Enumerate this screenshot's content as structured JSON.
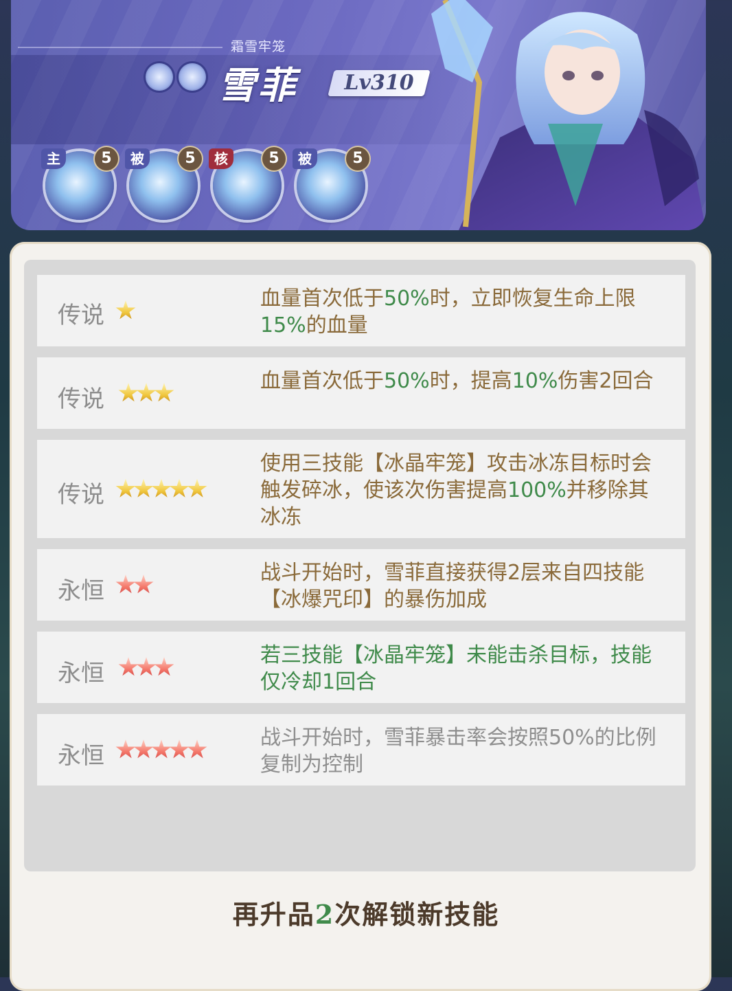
{
  "hero": {
    "subtitle": "霜雪牢笼",
    "name": "雪菲",
    "level": "Lv310",
    "element_icons": [
      "snowflake-icon",
      "keyhole-icon"
    ],
    "skills": [
      {
        "tag": "主",
        "level": "5",
        "icon": "ice-crystal-icon"
      },
      {
        "tag": "被",
        "level": "5",
        "icon": "frost-wing-icon"
      },
      {
        "tag": "核",
        "level": "5",
        "icon": "ice-chain-icon"
      },
      {
        "tag": "被",
        "level": "5",
        "icon": "snowflake-seal-icon"
      }
    ]
  },
  "traits": [
    {
      "grade": "传说",
      "stars": 1,
      "star_color": "gold",
      "desc": [
        {
          "t": "血量首次低于"
        },
        {
          "t": "50%",
          "g": true
        },
        {
          "t": "时，立即恢复生命上限"
        },
        {
          "t": "15%",
          "g": true
        },
        {
          "t": "的血量"
        }
      ]
    },
    {
      "grade": "传说",
      "stars": 3,
      "star_color": "gold",
      "desc": [
        {
          "t": "血量首次低于"
        },
        {
          "t": "50%",
          "g": true
        },
        {
          "t": "时，提高"
        },
        {
          "t": "10%",
          "g": true
        },
        {
          "t": "伤害2回合"
        }
      ]
    },
    {
      "grade": "传说",
      "stars": 5,
      "star_color": "gold",
      "desc": [
        {
          "t": "使用三技能【冰晶牢笼】攻击冰冻目标时会触发碎冰，使该次伤害提高"
        },
        {
          "t": "100%",
          "g": true
        },
        {
          "t": "并移除其冰冻"
        }
      ]
    },
    {
      "grade": "永恒",
      "stars": 2,
      "star_color": "red",
      "desc": [
        {
          "t": "战斗开始时，雪菲直接获得2层来自四技能【冰爆咒印】的暴伤加成"
        }
      ]
    },
    {
      "grade": "永恒",
      "stars": 3,
      "star_color": "red",
      "desc": [
        {
          "t": "若三技能【冰晶牢笼】未能击杀目标，技能仅冷却1回合",
          "g": true
        }
      ]
    },
    {
      "grade": "永恒",
      "stars": 5,
      "star_color": "red",
      "desc": [
        {
          "t": "战斗开始时，雪菲暴击率会按照50%的比例复制为控制"
        }
      ],
      "dim": true
    }
  ],
  "footer": {
    "prefix": "再升品",
    "count": "2",
    "suffix": "次解锁新技能"
  },
  "colors": {
    "desc_brown": "#8a6a3a",
    "desc_green": "#3f8a4a",
    "grade_grey": "#8d8d8d",
    "panel_bg": "#f4f2ee"
  }
}
